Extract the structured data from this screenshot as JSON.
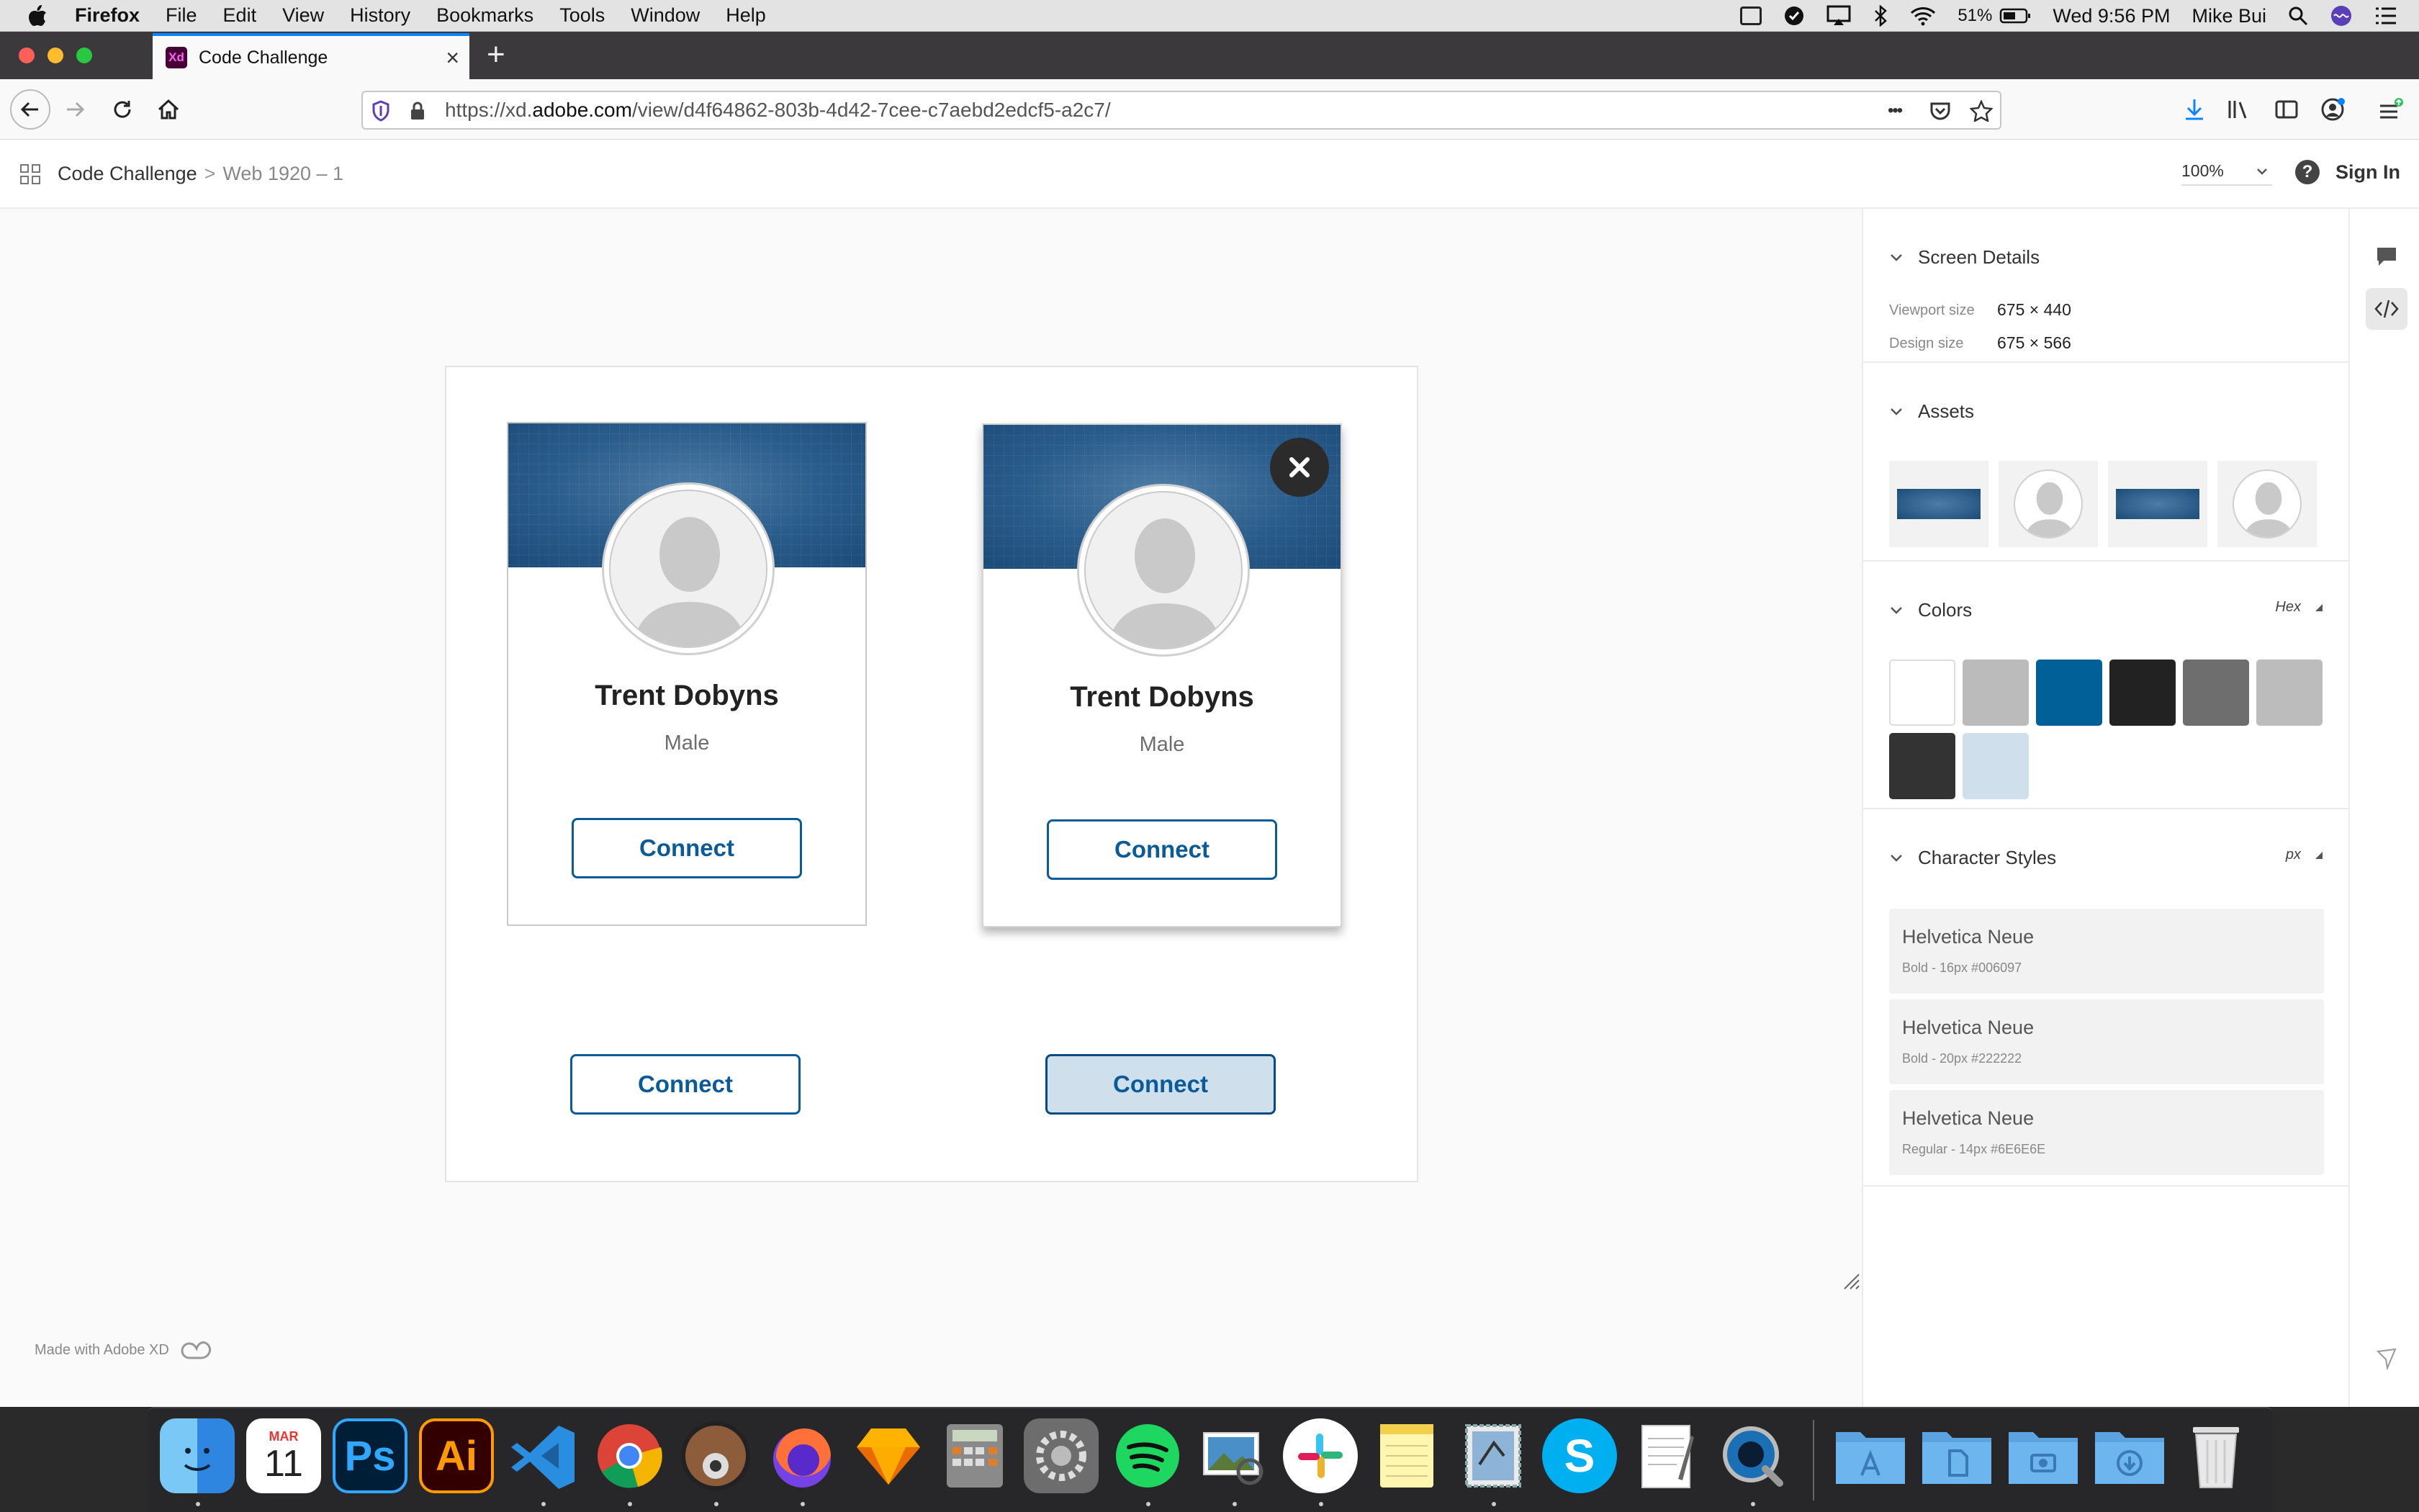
{
  "menubar": {
    "app": "Firefox",
    "items": [
      "File",
      "Edit",
      "View",
      "History",
      "Bookmarks",
      "Tools",
      "Window",
      "Help"
    ],
    "battery": "51%",
    "clock": "Wed 9:56 PM",
    "user": "Mike Bui"
  },
  "browser": {
    "tab_title": "Code Challenge",
    "tab_favicon": "Xd",
    "url_prefix": "https://xd.",
    "url_domain": "adobe.com",
    "url_path": "/view/d4f64862-803b-4d42-7cee-c7aebd2edcf5-a2c7/",
    "page_actions": "•••"
  },
  "xd": {
    "breadcrumb": {
      "project": "Code Challenge",
      "separator": ">",
      "screen": "Web 1920 – 1"
    },
    "zoom": "100%",
    "help": "?",
    "sign_in": "Sign In",
    "made_with": "Made with Adobe XD"
  },
  "cards": [
    {
      "name": "Trent Dobyns",
      "gender": "Male",
      "button": "Connect"
    },
    {
      "name": "Trent Dobyns",
      "gender": "Male",
      "button": "Connect"
    }
  ],
  "standalone_buttons": [
    {
      "label": "Connect",
      "state": "default"
    },
    {
      "label": "Connect",
      "state": "active"
    }
  ],
  "panel": {
    "screen_details": {
      "title": "Screen Details",
      "viewport_label": "Viewport size",
      "viewport_value": "675 × 440",
      "design_label": "Design size",
      "design_value": "675 × 566"
    },
    "assets": {
      "title": "Assets",
      "items": [
        "banner",
        "avatar",
        "banner",
        "avatar"
      ]
    },
    "colors": {
      "title": "Colors",
      "format": "Hex",
      "swatches": [
        "#ffffff",
        "#bbbbbb",
        "#006097",
        "#222222",
        "#6e6e6e",
        "#bcbcbc",
        "#333333",
        "#cfe0ec"
      ]
    },
    "character_styles": {
      "title": "Character Styles",
      "unit": "px",
      "items": [
        {
          "font": "Helvetica Neue",
          "detail": "Bold - 16px #006097"
        },
        {
          "font": "Helvetica Neue",
          "detail": "Bold - 20px #222222"
        },
        {
          "font": "Helvetica Neue",
          "detail": "Regular - 14px #6E6E6E"
        }
      ]
    }
  },
  "dock": {
    "calendar_month": "MAR",
    "calendar_day": "11",
    "apps": [
      "finder",
      "calendar",
      "photoshop",
      "illustrator",
      "vscode",
      "chrome",
      "app-eye",
      "firefox",
      "sketch",
      "calculator",
      "system-preferences",
      "spotify",
      "preview",
      "slack",
      "notes",
      "mail",
      "skype",
      "textedit",
      "quicktime",
      "applications-folder",
      "documents-folder",
      "screenshots-folder",
      "downloads-folder",
      "trash"
    ],
    "ps_label": "Ps",
    "ai_label": "Ai",
    "skype_label": "S"
  },
  "colors": {
    "brand_blue": "#0a5b97",
    "firefox_accent": "#0a84ff"
  }
}
